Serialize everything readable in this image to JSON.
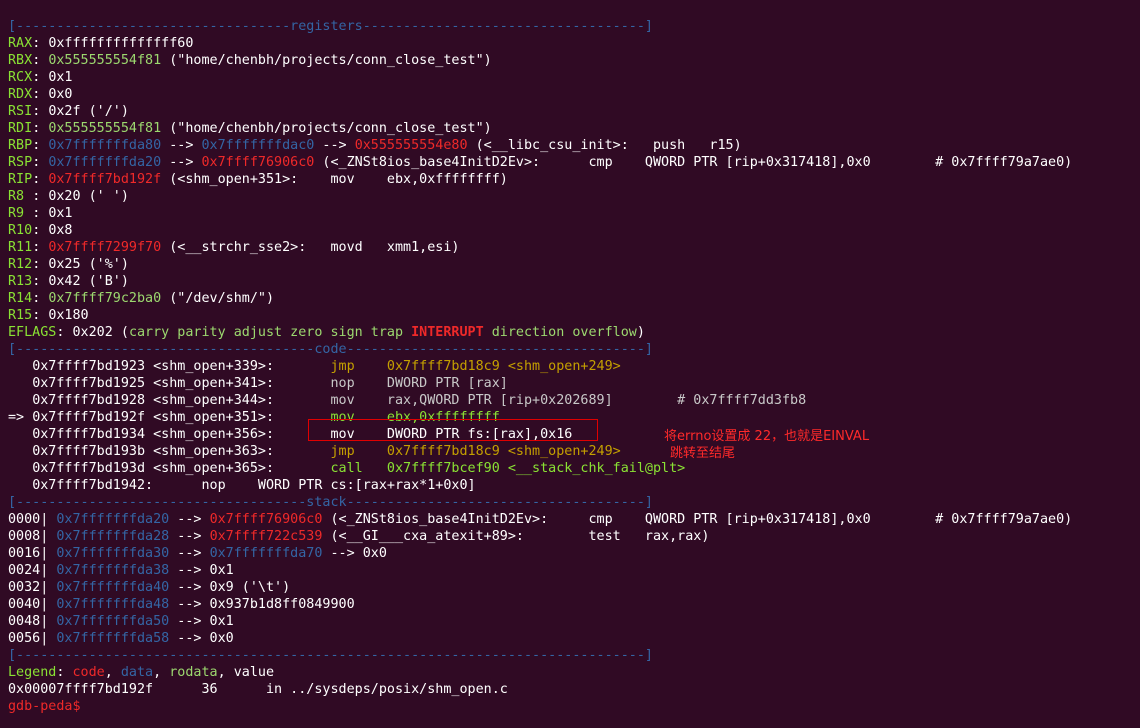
{
  "sections": {
    "registers": "[----------------------------------registers-----------------------------------]",
    "code": "[-------------------------------------code-------------------------------------]",
    "stack": "[------------------------------------stack-------------------------------------]",
    "end": "[------------------------------------------------------------------------------]"
  },
  "registers": [
    {
      "name": "RAX",
      "sep": ": ",
      "val": "0xffffffffffffff60",
      "val_color": "white",
      "rest": ""
    },
    {
      "name": "RBX",
      "sep": ": ",
      "val": "0x555555554f81",
      "val_color": "lgreen",
      "rest": " (\"home/chenbh/projects/conn_close_test\")"
    },
    {
      "name": "RCX",
      "sep": ": ",
      "val": "0x1",
      "val_color": "white",
      "rest": ""
    },
    {
      "name": "RDX",
      "sep": ": ",
      "val": "0x0",
      "val_color": "white",
      "rest": ""
    },
    {
      "name": "RSI",
      "sep": ": ",
      "val": "0x2f",
      "val_color": "white",
      "rest": " ('/')"
    },
    {
      "name": "RDI",
      "sep": ": ",
      "val": "0x555555554f81",
      "val_color": "lgreen",
      "rest": " (\"home/chenbh/projects/conn_close_test\")"
    },
    {
      "name": "RBP",
      "sep": ": ",
      "segments": [
        {
          "t": "0x7fffffffda80",
          "c": "blue"
        },
        {
          "t": " --> ",
          "c": "white"
        },
        {
          "t": "0x7fffffffdac0",
          "c": "blue"
        },
        {
          "t": " --> ",
          "c": "white"
        },
        {
          "t": "0x555555554e80",
          "c": "red"
        },
        {
          "t": " (<__libc_csu_init>:   push   r15)",
          "c": "white"
        }
      ]
    },
    {
      "name": "RSP",
      "sep": ": ",
      "segments": [
        {
          "t": "0x7fffffffda20",
          "c": "blue"
        },
        {
          "t": " --> ",
          "c": "white"
        },
        {
          "t": "0x7ffff76906c0",
          "c": "red"
        },
        {
          "t": " (<_ZNSt8ios_base4InitD2Ev>:      cmp    QWORD PTR [rip+0x317418],0x0        # 0x7ffff79a7ae0)",
          "c": "white"
        }
      ]
    },
    {
      "name": "RIP",
      "sep": ": ",
      "segments": [
        {
          "t": "0x7ffff7bd192f",
          "c": "red"
        },
        {
          "t": " (<shm_open+351>:    mov    ebx,0xffffffff)",
          "c": "white"
        }
      ]
    },
    {
      "name": "R8 ",
      "sep": ": ",
      "val": "0x20",
      "val_color": "white",
      "rest": " (' ')"
    },
    {
      "name": "R9 ",
      "sep": ": ",
      "val": "0x1",
      "val_color": "white",
      "rest": ""
    },
    {
      "name": "R10",
      "sep": ": ",
      "val": "0x8",
      "val_color": "white",
      "rest": ""
    },
    {
      "name": "R11",
      "sep": ": ",
      "segments": [
        {
          "t": "0x7ffff7299f70",
          "c": "red"
        },
        {
          "t": " (<__strchr_sse2>:   movd   xmm1,esi)",
          "c": "white"
        }
      ]
    },
    {
      "name": "R12",
      "sep": ": ",
      "val": "0x25",
      "val_color": "white",
      "rest": " ('%')"
    },
    {
      "name": "R13",
      "sep": ": ",
      "val": "0x42",
      "val_color": "white",
      "rest": " ('B')"
    },
    {
      "name": "R14",
      "sep": ": ",
      "segments": [
        {
          "t": "0x7ffff79c2ba0",
          "c": "lgreen"
        },
        {
          "t": " (\"/dev/shm/\")",
          "c": "white"
        }
      ]
    },
    {
      "name": "R15",
      "sep": ": ",
      "val": "0x180",
      "val_color": "white",
      "rest": ""
    }
  ],
  "eflags": {
    "label": "EFLAGS",
    "value": "0x202",
    "open": " (",
    "flags_pre": "carry parity adjust zero sign trap ",
    "flag_set": "INTERRUPT",
    "flags_post": " direction overflow",
    "close": ")"
  },
  "code": [
    {
      "prefix": "   ",
      "addr": "0x7ffff7bd1923 <shm_open+339>:",
      "pad": "       ",
      "op": "jmp",
      "args": "    0x7ffff7bd18c9 <shm_open+249>",
      "cls": "olive"
    },
    {
      "prefix": "   ",
      "addr": "0x7ffff7bd1925 <shm_open+341>:",
      "pad": "       ",
      "op": "nop",
      "args": "    DWORD PTR [rax]",
      "cls": "dim"
    },
    {
      "prefix": "   ",
      "addr": "0x7ffff7bd1928 <shm_open+344>:",
      "pad": "       ",
      "op": "mov",
      "args": "    rax,QWORD PTR [rip+0x202689]        # 0x7ffff7dd3fb8",
      "cls": "dim"
    },
    {
      "prefix": "=> ",
      "addr": "0x7ffff7bd192f <shm_open+351>:",
      "pad": "       ",
      "op": "mov",
      "args": "    ebx,0xffffffff",
      "cls": "green"
    },
    {
      "prefix": "   ",
      "addr": "0x7ffff7bd1934 <shm_open+356>:",
      "pad": "       ",
      "op": "mov",
      "args": "    DWORD PTR fs:[rax],0x16",
      "cls": "white"
    },
    {
      "prefix": "   ",
      "addr": "0x7ffff7bd193b <shm_open+363>:",
      "pad": "       ",
      "op": "jmp",
      "args": "    0x7ffff7bd18c9 <shm_open+249>",
      "cls": "olive"
    },
    {
      "prefix": "   ",
      "addr": "0x7ffff7bd193d <shm_open+365>:",
      "pad": "       ",
      "op": "call",
      "args": "   0x7ffff7bcef90 <__stack_chk_fail@plt>",
      "cls": "green"
    },
    {
      "prefix": "   ",
      "addr": "0x7ffff7bd1942:",
      "pad": "      ",
      "op": "nop",
      "args": "    WORD PTR cs:[rax+rax*1+0x0]",
      "cls": "white"
    }
  ],
  "stack": [
    {
      "off": "0000| ",
      "addr": "0x7fffffffda20",
      "segments": [
        {
          "t": " --> ",
          "c": "white"
        },
        {
          "t": "0x7ffff76906c0",
          "c": "red"
        },
        {
          "t": " (<_ZNSt8ios_base4InitD2Ev>:     cmp    QWORD PTR [rip+0x317418],0x0        # 0x7ffff79a7ae0)",
          "c": "white"
        }
      ]
    },
    {
      "off": "0008| ",
      "addr": "0x7fffffffda28",
      "segments": [
        {
          "t": " --> ",
          "c": "white"
        },
        {
          "t": "0x7ffff722c539",
          "c": "red"
        },
        {
          "t": " (<__GI___cxa_atexit+89>:        test   rax,rax)",
          "c": "white"
        }
      ]
    },
    {
      "off": "0016| ",
      "addr": "0x7fffffffda30",
      "segments": [
        {
          "t": " --> ",
          "c": "white"
        },
        {
          "t": "0x7fffffffda70",
          "c": "blue"
        },
        {
          "t": " --> 0x0",
          "c": "white"
        }
      ]
    },
    {
      "off": "0024| ",
      "addr": "0x7fffffffda38",
      "segments": [
        {
          "t": " --> 0x1",
          "c": "white"
        }
      ]
    },
    {
      "off": "0032| ",
      "addr": "0x7fffffffda40",
      "segments": [
        {
          "t": " --> 0x9 ('\\t')",
          "c": "white"
        }
      ]
    },
    {
      "off": "0040| ",
      "addr": "0x7fffffffda48",
      "segments": [
        {
          "t": " --> 0x937b1d8ff0849900",
          "c": "white"
        }
      ]
    },
    {
      "off": "0048| ",
      "addr": "0x7fffffffda50",
      "segments": [
        {
          "t": " --> 0x1",
          "c": "white"
        }
      ]
    },
    {
      "off": "0056| ",
      "addr": "0x7fffffffda58",
      "segments": [
        {
          "t": " --> 0x0",
          "c": "white"
        }
      ]
    }
  ],
  "legend": {
    "label": "Legend",
    "sep": ": ",
    "code": "code",
    "c1": ", ",
    "data": "data",
    "c2": ", ",
    "rodata": "rodata",
    "c3": ", ",
    "value": "value"
  },
  "location": {
    "addr": "0x00007ffff7bd192f",
    "pad1": "      ",
    "line": "36",
    "pad2": "      ",
    "file": "in ../sysdeps/posix/shm_open.c"
  },
  "prompt": "gdb-peda$",
  "annotations": {
    "line1": "将errno设置成 22，也就是EINVAL",
    "line2": "跳转至结尾"
  }
}
